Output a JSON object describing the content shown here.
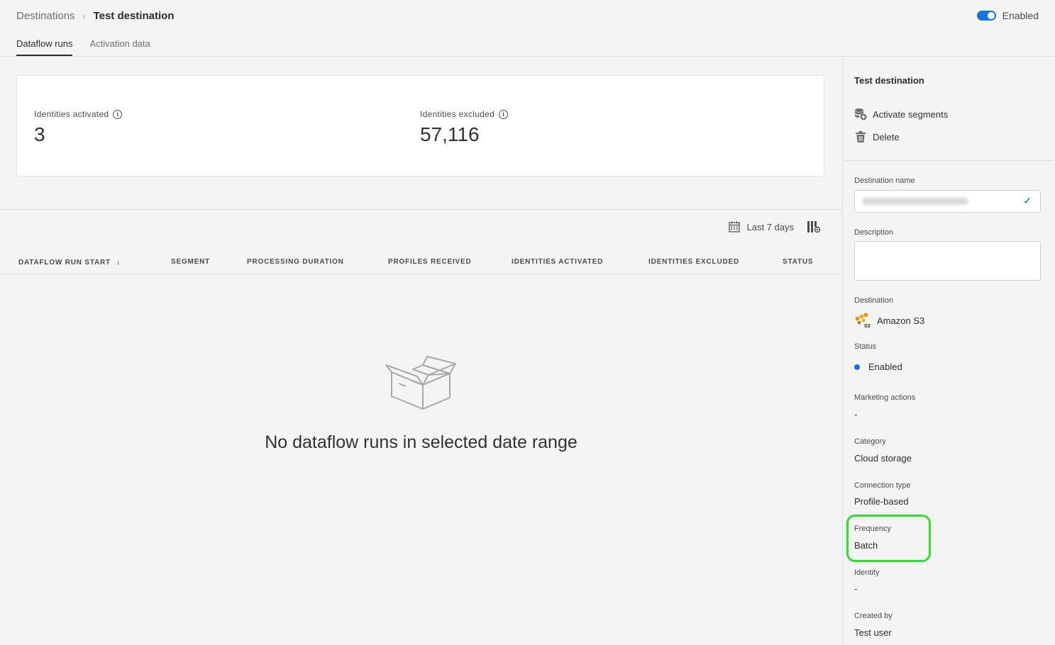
{
  "breadcrumb": {
    "parent": "Destinations",
    "separator": "›",
    "current": "Test destination"
  },
  "header": {
    "toggle_label": "Enabled",
    "toggle_on": true,
    "accent_color": "#1473e6"
  },
  "tabs": [
    {
      "label": "Dataflow runs",
      "active": true
    },
    {
      "label": "Activation data",
      "active": false
    }
  ],
  "summary": {
    "activated": {
      "label": "Identities activated",
      "value": "3",
      "icon": "info-icon"
    },
    "excluded": {
      "label": "Identities excluded",
      "value": "57,116",
      "icon": "info-icon"
    }
  },
  "toolbar": {
    "date_range": "Last 7 days",
    "calendar_icon": "calendar-icon",
    "settings_icon": "column-settings-icon"
  },
  "table": {
    "columns": [
      "DATAFLOW RUN START",
      "SEGMENT",
      "PROCESSING DURATION",
      "PROFILES RECEIVED",
      "IDENTITIES ACTIVATED",
      "IDENTITIES EXCLUDED",
      "STATUS"
    ],
    "sort_icon": "arrow-down-icon",
    "rows": []
  },
  "empty_state": {
    "icon": "empty-box-icon",
    "message": "No dataflow runs in selected date range"
  },
  "sidebar": {
    "title": "Test destination",
    "actions": [
      {
        "label": "Activate segments",
        "icon": "activate-segments-icon"
      },
      {
        "label": "Delete",
        "icon": "trash-icon"
      }
    ],
    "fields": {
      "destination_name_label": "Destination name",
      "description_label": "Description",
      "destination_label": "Destination",
      "destination_value": "Amazon S3",
      "status_label": "Status",
      "status_value": "Enabled",
      "marketing_label": "Marketing actions",
      "marketing_value": "-",
      "category_label": "Category",
      "category_value": "Cloud storage",
      "connection_label": "Connection type",
      "connection_value": "Profile-based",
      "frequency_label": "Frequency",
      "frequency_value": "Batch",
      "identity_label": "Identity",
      "identity_value": "-",
      "created_label": "Created by",
      "created_value": "Test user"
    },
    "highlight_color": "#2fe02f"
  }
}
